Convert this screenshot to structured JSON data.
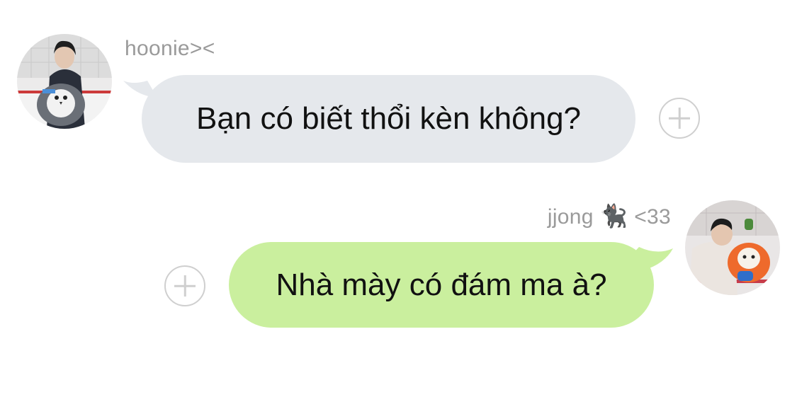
{
  "messages": [
    {
      "sender": "hoonie><",
      "text": "Bạn có biết thổi kèn không?",
      "side": "left",
      "bubble_color": "#e5e8ec"
    },
    {
      "sender": "jjong",
      "sender_emoji": "🐈‍⬛",
      "sender_suffix": "<33",
      "text": "Nhà mày có đám ma à?",
      "side": "right",
      "bubble_color": "#caef9e"
    }
  ],
  "icons": {
    "add_reaction": "plus-circle-icon"
  },
  "colors": {
    "sender_name": "#9a9a9a",
    "add_icon": "#cfcfcf"
  }
}
